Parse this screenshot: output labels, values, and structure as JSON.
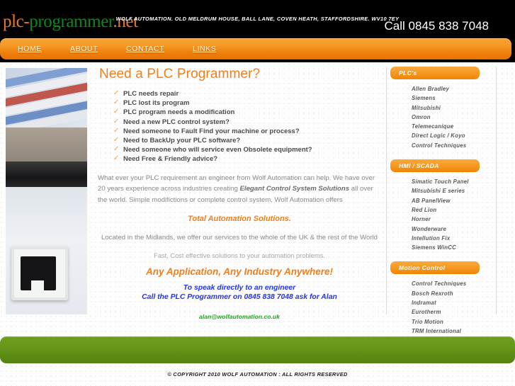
{
  "header": {
    "logo": {
      "segments": [
        {
          "text": "plc-",
          "color": "#E8762C"
        },
        {
          "text": "programmer",
          "color": "#0A8A14"
        },
        {
          "text": ".net",
          "color": "#E8762C"
        }
      ],
      "full_text": "plc-programmer.net"
    },
    "phone_label": "Call 0845 838 7048",
    "background_color": "#000000"
  },
  "nav": {
    "accent_color": "#F18B16",
    "items": [
      {
        "label": "HOME"
      },
      {
        "label": "ABOUT"
      },
      {
        "label": "CONTACT"
      },
      {
        "label": "LINKS"
      }
    ]
  },
  "main": {
    "headline": "Need a PLC Programmer?",
    "headline_color": "#F07F1A",
    "bullets": [
      "PLC needs repair",
      "PLC lost its program",
      "PLC program needs a modification",
      "Need a new PLC control system?",
      "Need someone to Fault Find your machine or process?",
      "Need to BackUp your PLC software?",
      "Need someone who will service even Obsolete equipment?",
      "Need Free & Friendly advice?"
    ],
    "paragraph_part1": "What ever your PLC requirement  an engineer from Wolf Automation can help. We have over 20 years experience across  industries creating ",
    "paragraph_emphasis": "Elegant Control System Solutions",
    "paragraph_part2": " all over the world.  Simple modifictions or complete control system, Wolf Automation offers",
    "total_automation": "Total Automation Solutions.",
    "located": "Located in the Midlands, we offer our services to the whole of the UK & the rest of the World",
    "fast_cost": "Fast, Cost effective solutions to your automation problems.",
    "any_application": "Any Application, Any Industry Anywhere!",
    "speak_line1": "To speak directly to an engineer",
    "speak_line2": "Call the PLC Programmer on 0845 838 7048 ask for Alan",
    "email": "alan@wolfautomation.co.uk",
    "email_color": "#17A81A"
  },
  "sidebar": {
    "sections": [
      {
        "title": "PLC's",
        "items": [
          "Allen Bradley",
          "Siemens",
          "Mitsubishi",
          "Omron",
          "Telemecanique",
          "Direct Logic / Koyo",
          "Control Techniques"
        ]
      },
      {
        "title": "HMI / SCADA",
        "items": [
          "Simatic Touch Panel",
          "Mitsubishi E series",
          "AB PanelView",
          "Red Lion",
          "Horner",
          "Wonderware",
          "Intellution Fix",
          "Siemens WinCC"
        ]
      },
      {
        "title": "Motion Control",
        "items": [
          "Control Techniques",
          "Bosch Rexroth",
          "Indramat",
          "Eurotherm",
          "Trio Motion",
          "TRM International"
        ]
      }
    ]
  },
  "footer": {
    "address": "WOLF AUTOMATION. OLD MELDRUM HOUSE, BALL LANE, COVEN HEATH, STAFFORDSHIRE. WV10 7EY",
    "copyright": "© COPYRIGHT 2010 WOLF AUTOMATION : ALL RIGHTS RESERVED",
    "bar_color": "#62931A"
  }
}
